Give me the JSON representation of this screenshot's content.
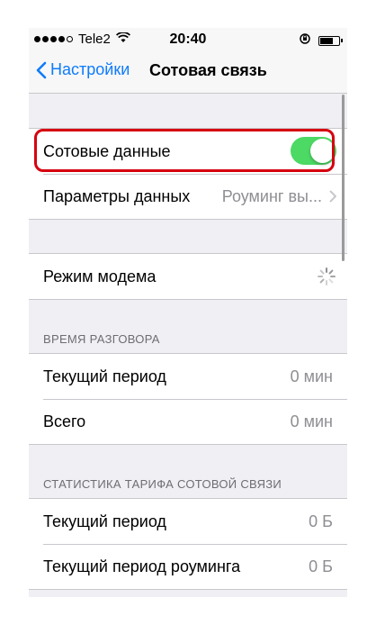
{
  "status_bar": {
    "carrier": "Tele2",
    "time": "20:40",
    "icons": [
      "signal-dots-icon",
      "wifi-icon",
      "orientation-lock-icon",
      "battery-icon"
    ]
  },
  "nav": {
    "back_label": "Настройки",
    "title": "Сотовая связь"
  },
  "group1": {
    "cellular_data_label": "Сотовые данные",
    "cellular_data_on": true,
    "data_options_label": "Параметры данных",
    "data_options_value": "Роуминг вы..."
  },
  "group2": {
    "hotspot_label": "Режим модема"
  },
  "talk_time": {
    "header": "ВРЕМЯ РАЗГОВОРА",
    "rows": [
      {
        "label": "Текущий период",
        "value": "0 мин"
      },
      {
        "label": "Всего",
        "value": "0 мин"
      }
    ]
  },
  "tariff_stats": {
    "header": "СТАТИСТИКА ТАРИФА СОТОВОЙ СВЯЗИ",
    "rows": [
      {
        "label": "Текущий период",
        "value": "0 Б"
      },
      {
        "label": "Текущий период роуминга",
        "value": "0 Б"
      }
    ]
  },
  "colors": {
    "accent": "#0e7bfb",
    "toggle_on": "#4cd964",
    "highlight": "#d6000f"
  }
}
